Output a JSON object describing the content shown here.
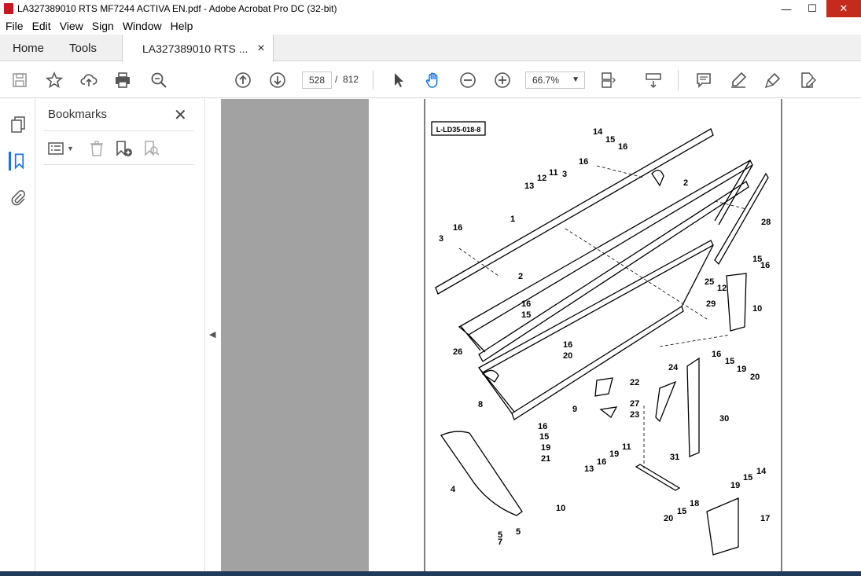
{
  "window": {
    "title": "LA327389010 RTS MF7244 ACTIVA EN.pdf - Adobe Acrobat Pro DC (32-bit)",
    "minimize": "—",
    "maximize": "☐",
    "close": "✕"
  },
  "menu": [
    "File",
    "Edit",
    "View",
    "Sign",
    "Window",
    "Help"
  ],
  "tabs": {
    "home": "Home",
    "tools": "Tools",
    "document": "LA327389010 RTS ...",
    "document_close": "×"
  },
  "toolbar": {
    "current_page": "528",
    "page_separator": "/",
    "total_pages": "812",
    "zoom": "66.7%"
  },
  "bookmarks": {
    "title": "Bookmarks",
    "close": "✕"
  },
  "diagram": {
    "ref_code": "L-LD35-018-8",
    "callouts": [
      "14",
      "15",
      "16",
      "16",
      "2",
      "13",
      "12",
      "11",
      "3",
      "1",
      "28",
      "3",
      "16",
      "2",
      "15",
      "16",
      "25",
      "12",
      "29",
      "10",
      "16",
      "15",
      "26",
      "16",
      "20",
      "24",
      "16",
      "15",
      "19",
      "20",
      "22",
      "27",
      "23",
      "8",
      "9",
      "30",
      "16",
      "15",
      "19",
      "21",
      "31",
      "19",
      "11",
      "16",
      "13",
      "14",
      "15",
      "19",
      "4",
      "10",
      "18",
      "15",
      "20",
      "17",
      "7",
      "5",
      "5"
    ]
  }
}
